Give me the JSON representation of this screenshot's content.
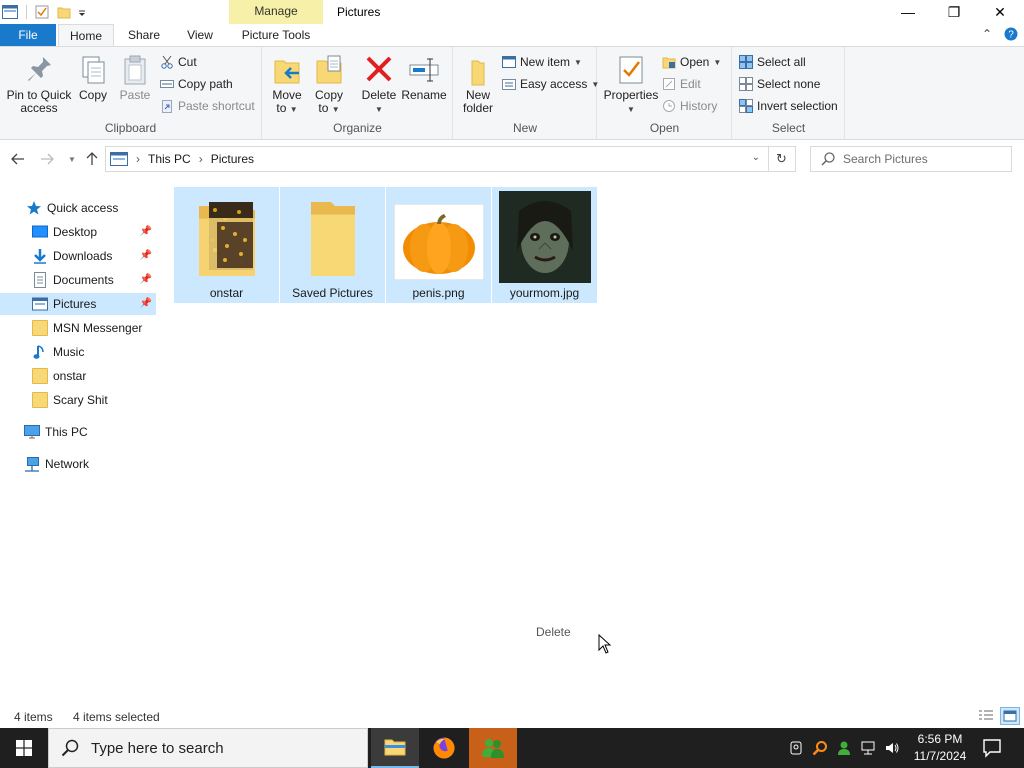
{
  "window": {
    "title": "Pictures",
    "manage_tab": "Manage",
    "controls": {
      "minimize": "—",
      "maximize": "❐",
      "close": "✕"
    }
  },
  "tabs": {
    "file": "File",
    "home": "Home",
    "share": "Share",
    "view": "View",
    "picture_tools": "Picture Tools"
  },
  "ribbon": {
    "clipboard": {
      "label": "Clipboard",
      "pin": "Pin to Quick access",
      "pin_line1": "Pin to Quick",
      "pin_line2": "access",
      "copy": "Copy",
      "paste": "Paste",
      "cut": "Cut",
      "copy_path": "Copy path",
      "paste_shortcut": "Paste shortcut"
    },
    "organize": {
      "label": "Organize",
      "move_to_1": "Move",
      "move_to_2": "to",
      "copy_to_1": "Copy",
      "copy_to_2": "to",
      "delete": "Delete",
      "rename": "Rename"
    },
    "new": {
      "label": "New",
      "new_folder_1": "New",
      "new_folder_2": "folder",
      "new_item": "New item",
      "easy_access": "Easy access"
    },
    "open": {
      "label": "Open",
      "properties": "Properties",
      "open": "Open",
      "edit": "Edit",
      "history": "History"
    },
    "select": {
      "label": "Select",
      "select_all": "Select all",
      "select_none": "Select none",
      "invert_selection": "Invert selection"
    }
  },
  "address": {
    "crumbs": [
      "This PC",
      "Pictures"
    ],
    "search_placeholder": "Search Pictures"
  },
  "nav": {
    "quick_access": "Quick access",
    "items": [
      {
        "label": "Desktop",
        "pinned": true
      },
      {
        "label": "Downloads",
        "pinned": true
      },
      {
        "label": "Documents",
        "pinned": true
      },
      {
        "label": "Pictures",
        "pinned": true,
        "selected": true
      },
      {
        "label": "MSN Messenger"
      },
      {
        "label": "Music"
      },
      {
        "label": "onstar"
      },
      {
        "label": "Scary Shit"
      }
    ],
    "this_pc": "This PC",
    "network": "Network"
  },
  "files": [
    {
      "name": "onstar",
      "kind": "folder-with-image"
    },
    {
      "name": "Saved Pictures",
      "kind": "folder"
    },
    {
      "name": "penis.png",
      "kind": "image-pumpkin"
    },
    {
      "name": "yourmom.jpg",
      "kind": "image-dark"
    }
  ],
  "tooltip": {
    "text": "Delete"
  },
  "status": {
    "count": "4 items",
    "selected": "4 items selected"
  },
  "taskbar": {
    "search_placeholder": "Type here to search",
    "time": "6:56 PM",
    "date": "11/7/2024"
  },
  "colors": {
    "accent": "#1979ca",
    "selection": "#cce8ff",
    "manage_tab": "#f6f0a8",
    "taskbar": "#1f1f1f"
  }
}
